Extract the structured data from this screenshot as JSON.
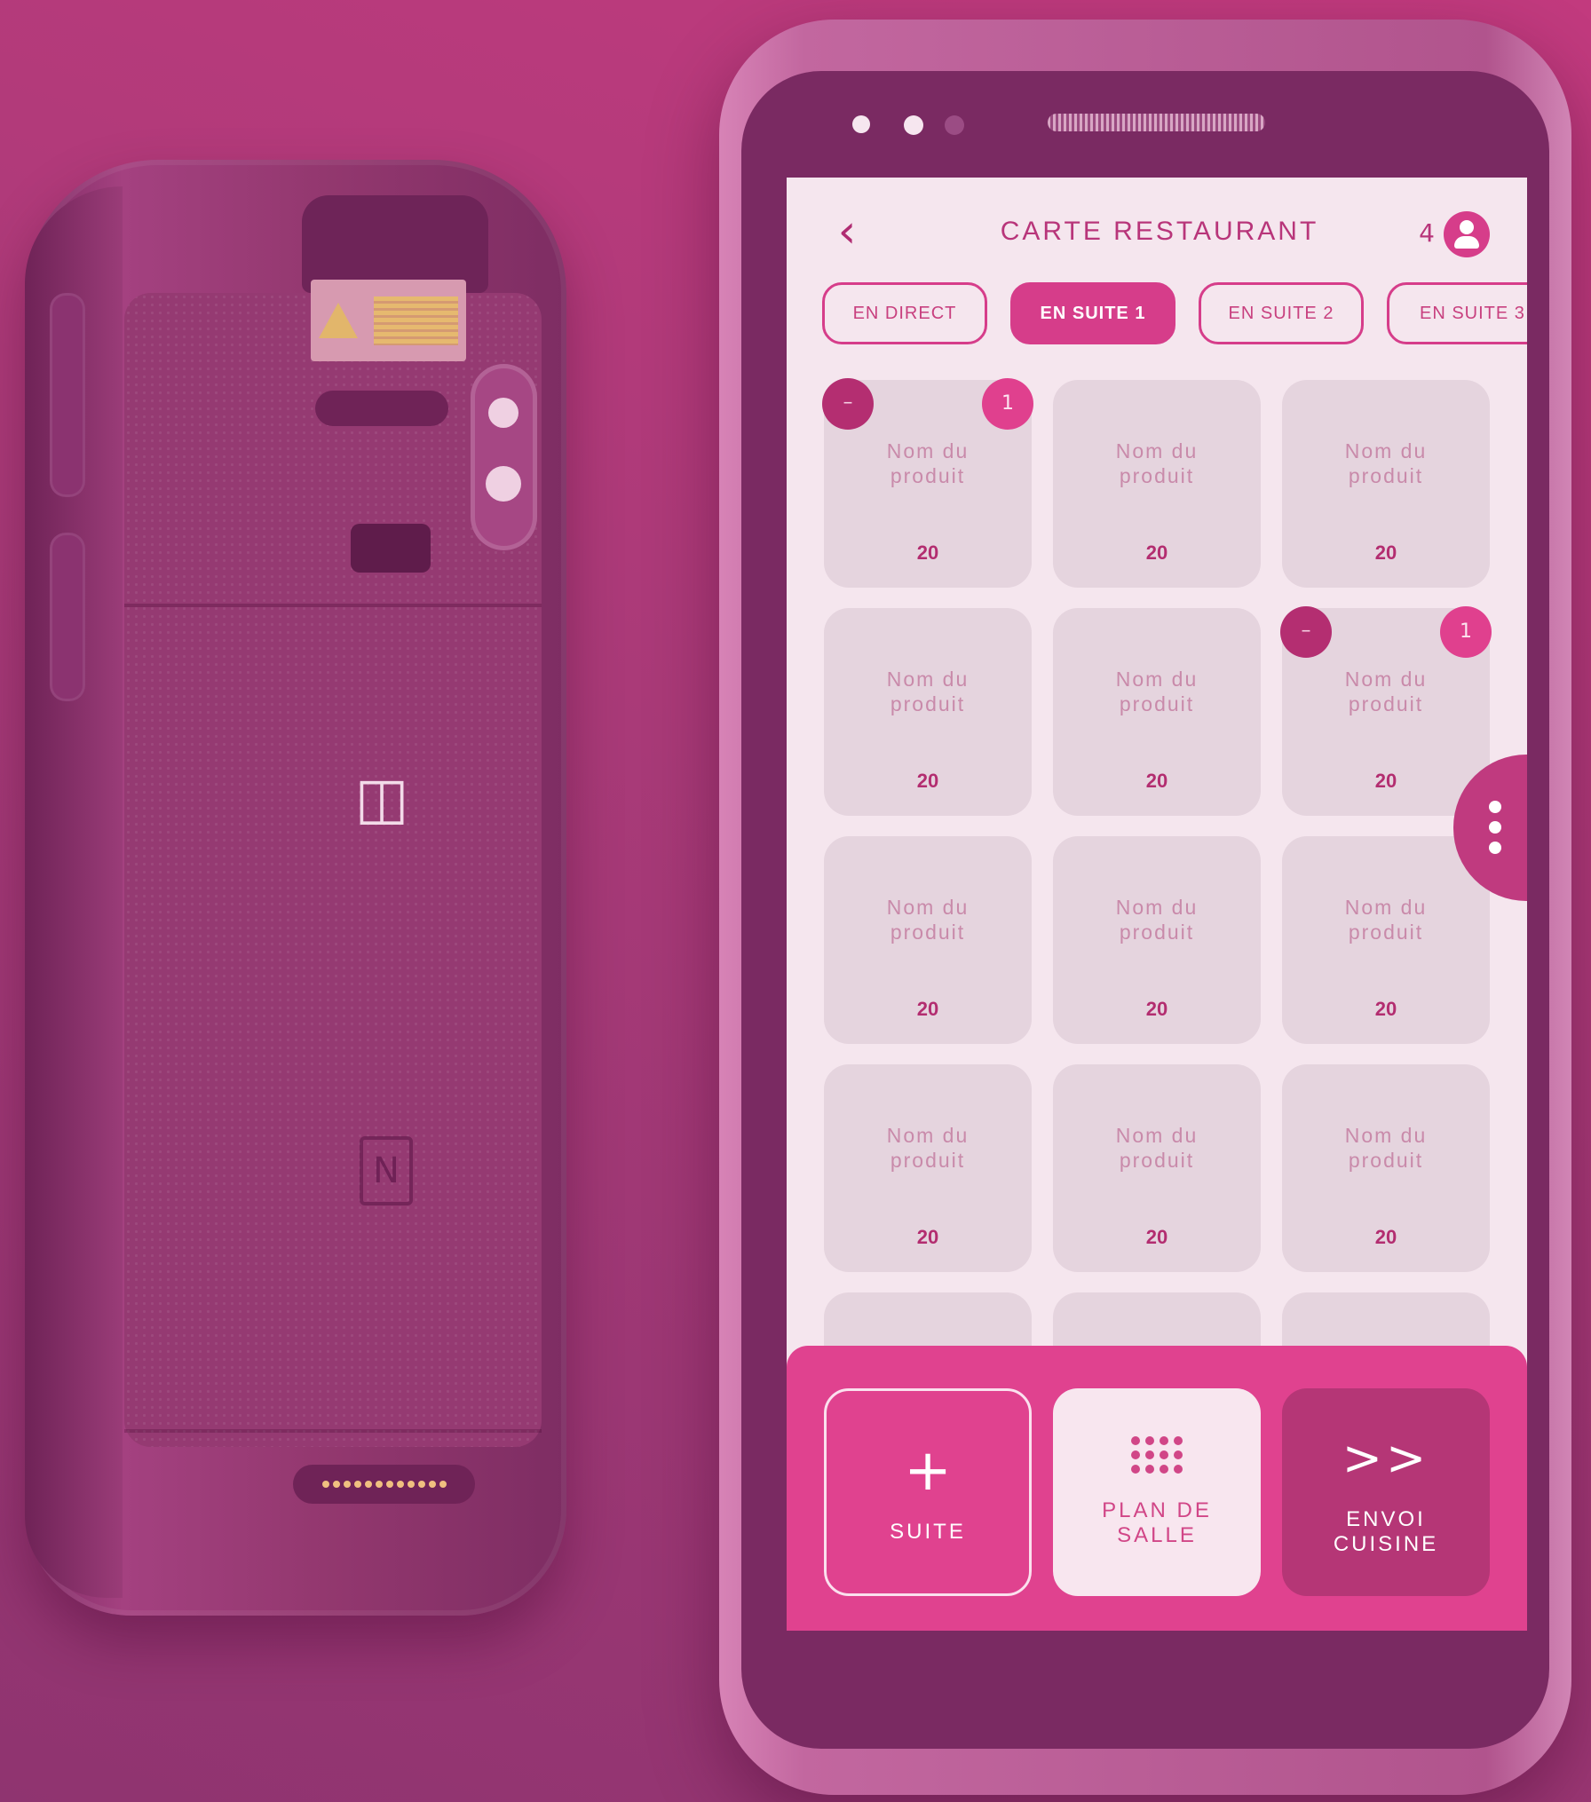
{
  "screen": {
    "title": "CARTE RESTAURANT",
    "back_icon": "chevron-left-icon",
    "guest_count": "4",
    "user_icon": "user-icon"
  },
  "tabs": [
    {
      "label": "EN DIRECT",
      "active": false
    },
    {
      "label": "EN SUITE 1",
      "active": true
    },
    {
      "label": "EN SUITE 2",
      "active": false
    },
    {
      "label": "EN SUITE 3",
      "active": false
    }
  ],
  "products": [
    {
      "name": "Nom du\nproduit",
      "price": "20",
      "qty": "1",
      "minus": "–"
    },
    {
      "name": "Nom du\nproduit",
      "price": "20"
    },
    {
      "name": "Nom du\nproduit",
      "price": "20"
    },
    {
      "name": "Nom du\nproduit",
      "price": "20"
    },
    {
      "name": "Nom du\nproduit",
      "price": "20"
    },
    {
      "name": "Nom du\nproduit",
      "price": "20",
      "qty": "1",
      "minus": "–"
    },
    {
      "name": "Nom du\nproduit",
      "price": "20"
    },
    {
      "name": "Nom du\nproduit",
      "price": "20"
    },
    {
      "name": "Nom du\nproduit",
      "price": "20"
    },
    {
      "name": "Nom du\nproduit",
      "price": "20"
    },
    {
      "name": "Nom du\nproduit",
      "price": "20"
    },
    {
      "name": "Nom du\nproduit",
      "price": "20"
    }
  ],
  "actions": {
    "suite": {
      "icon": "+",
      "label": "SUITE"
    },
    "plan": {
      "label": "PLAN DE\nSALLE"
    },
    "envoi": {
      "icon": ">>",
      "label": "ENVOI\nCUISINE"
    }
  },
  "colors": {
    "accent": "#d63d8a",
    "dark_accent": "#b42e71",
    "screen_bg": "#f5e6ee",
    "card_bg": "#e5d4de",
    "background": "#a93a78"
  }
}
